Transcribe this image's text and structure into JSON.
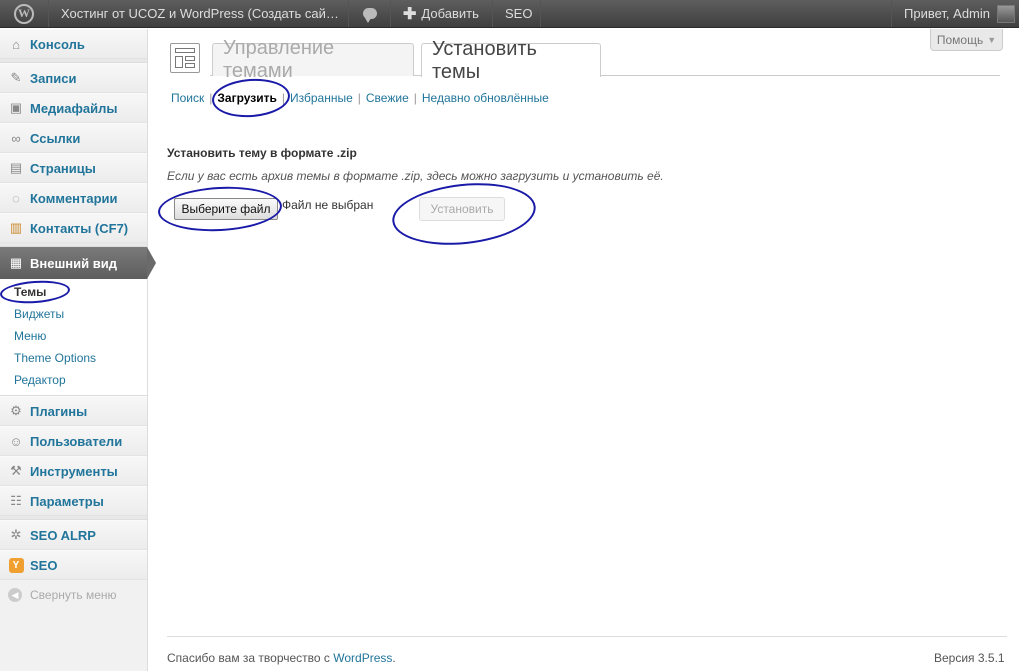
{
  "adminbar": {
    "site_title": "Хостинг от UCOZ и WordPress (Создать сай…",
    "new_label": "Добавить",
    "seo_label": "SEO",
    "greeting": "Привет, Admin"
  },
  "sidebar": {
    "items": [
      {
        "label": "Консоль",
        "icon": "home-icon"
      },
      {
        "label": "Записи",
        "icon": "pin-icon"
      },
      {
        "label": "Медиафайлы",
        "icon": "media-icon"
      },
      {
        "label": "Ссылки",
        "icon": "link-icon"
      },
      {
        "label": "Страницы",
        "icon": "page-icon"
      },
      {
        "label": "Комментарии",
        "icon": "comment-icon"
      },
      {
        "label": "Контакты (CF7)",
        "icon": "contact-icon"
      },
      {
        "label": "Внешний вид",
        "icon": "appearance-icon"
      },
      {
        "label": "Плагины",
        "icon": "plugin-icon"
      },
      {
        "label": "Пользователи",
        "icon": "users-icon"
      },
      {
        "label": "Инструменты",
        "icon": "tools-icon"
      },
      {
        "label": "Параметры",
        "icon": "settings-icon"
      },
      {
        "label": "SEO ALRP",
        "icon": "gear-icon"
      },
      {
        "label": "SEO",
        "icon": "seo-icon"
      }
    ],
    "submenu": [
      "Темы",
      "Виджеты",
      "Меню",
      "Theme Options",
      "Редактор"
    ],
    "collapse_label": "Свернуть меню"
  },
  "help_label": "Помощь",
  "tabs": [
    "Управление темами",
    "Установить темы"
  ],
  "subsub": [
    "Поиск",
    "Загрузить",
    "Избранные",
    "Свежие",
    "Недавно обновлённые"
  ],
  "upload": {
    "heading": "Установить тему в формате .zip",
    "description": "Если у вас есть архив темы в формате .zip, здесь можно загрузить и установить её.",
    "file_button": "Выберите файл",
    "file_status": "Файл не выбран",
    "install_button": "Установить"
  },
  "footer": {
    "thanks_prefix": "Спасибо вам за творчество с",
    "wordpress_link": "WordPress",
    "thanks_suffix": ".",
    "version": "Версия 3.5.1"
  },
  "colors": {
    "link": "#21759b",
    "annotation": "#1a1aa8"
  }
}
